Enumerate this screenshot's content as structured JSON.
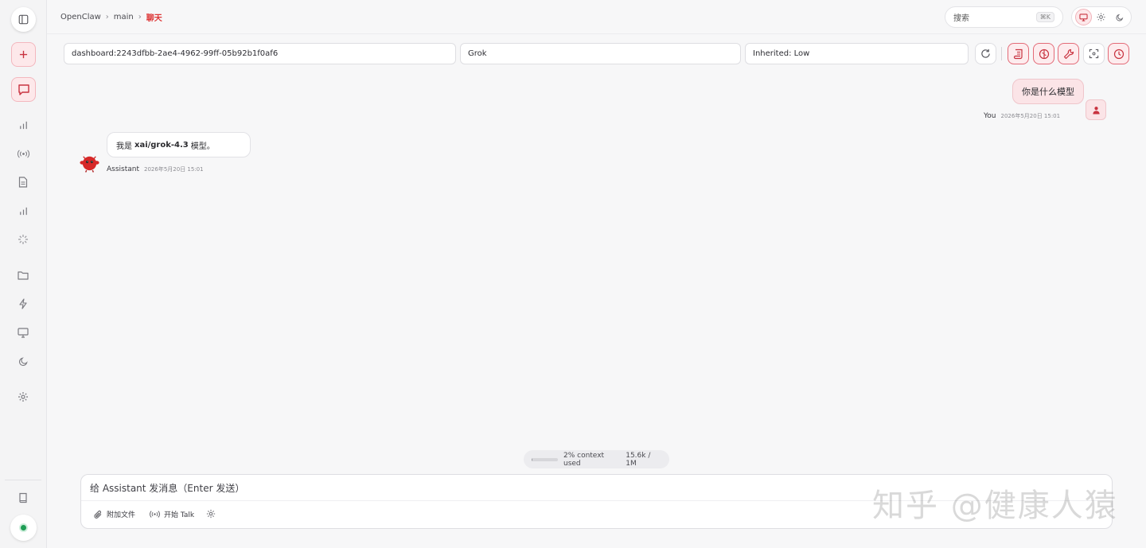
{
  "breadcrumb": {
    "root": "OpenClaw",
    "agent": "main",
    "current": "聊天"
  },
  "search": {
    "placeholder": "搜索",
    "shortcut": "⌘K"
  },
  "theme": {
    "options": [
      "monitor-icon",
      "sun-icon",
      "moon-icon"
    ],
    "selected": "monitor-icon"
  },
  "session": {
    "key": "dashboard:2243dfbb-2ae4-4962-99ff-05b92b1f0af6",
    "model": "Grok",
    "thinking": "Inherited: Low"
  },
  "messages": [
    {
      "role": "user",
      "sender": "You",
      "text": "你是什么模型",
      "time": "2026年5月20日 15:01"
    },
    {
      "role": "assistant",
      "sender": "Assistant",
      "prefix": "我是",
      "bold": "xai/grok-4.3",
      "suffix": "模型。",
      "time": "2026年5月20日 15:01"
    }
  ],
  "context": {
    "label": "2% context used",
    "usage": "15.6k / 1M",
    "fraction": 0.02
  },
  "composer": {
    "placeholder": "给 Assistant 发消息（Enter 发送）",
    "attach_label": "附加文件",
    "talk_label": "开始 Talk"
  },
  "watermark": "知乎 @健康人猿",
  "colors": {
    "accent": "#d33a48",
    "status_ok": "#1f9d55"
  }
}
